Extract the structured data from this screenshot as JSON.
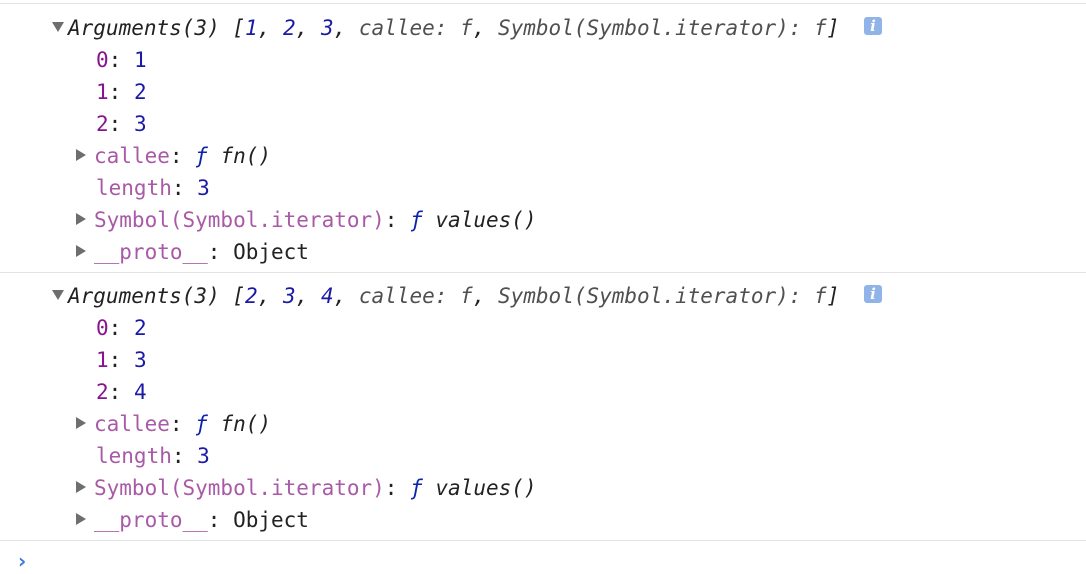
{
  "entries": [
    {
      "summary": {
        "name": "Arguments(3)",
        "open": "[",
        "values": [
          "1",
          "2",
          "3"
        ],
        "callee_label": "callee: f",
        "iterator_label": "Symbol(Symbol.iterator): f",
        "close": "]"
      },
      "items": [
        {
          "key": "0",
          "value": "1"
        },
        {
          "key": "1",
          "value": "2"
        },
        {
          "key": "2",
          "value": "3"
        }
      ],
      "callee": {
        "key": "callee",
        "f": "ƒ",
        "value": "fn()"
      },
      "length": {
        "key": "length",
        "value": "3"
      },
      "iterator": {
        "key": "Symbol(Symbol.iterator)",
        "f": "ƒ",
        "value": "values()"
      },
      "proto": {
        "key": "__proto__",
        "value": "Object"
      }
    },
    {
      "summary": {
        "name": "Arguments(3)",
        "open": "[",
        "values": [
          "2",
          "3",
          "4"
        ],
        "callee_label": "callee: f",
        "iterator_label": "Symbol(Symbol.iterator): f",
        "close": "]"
      },
      "items": [
        {
          "key": "0",
          "value": "2"
        },
        {
          "key": "1",
          "value": "3"
        },
        {
          "key": "2",
          "value": "4"
        }
      ],
      "callee": {
        "key": "callee",
        "f": "ƒ",
        "value": "fn()"
      },
      "length": {
        "key": "length",
        "value": "3"
      },
      "iterator": {
        "key": "Symbol(Symbol.iterator)",
        "f": "ƒ",
        "value": "values()"
      },
      "proto": {
        "key": "__proto__",
        "value": "Object"
      }
    }
  ],
  "info_icon_glyph": "i",
  "prompt_glyph": "›",
  "colors": {
    "index": "#881391",
    "number": "#1a1aa6",
    "dim_property": "#a85aa6",
    "function_keyword": "#0d22aa",
    "prompt": "#3b78e7",
    "info_icon_bg": "#90b4e8"
  }
}
